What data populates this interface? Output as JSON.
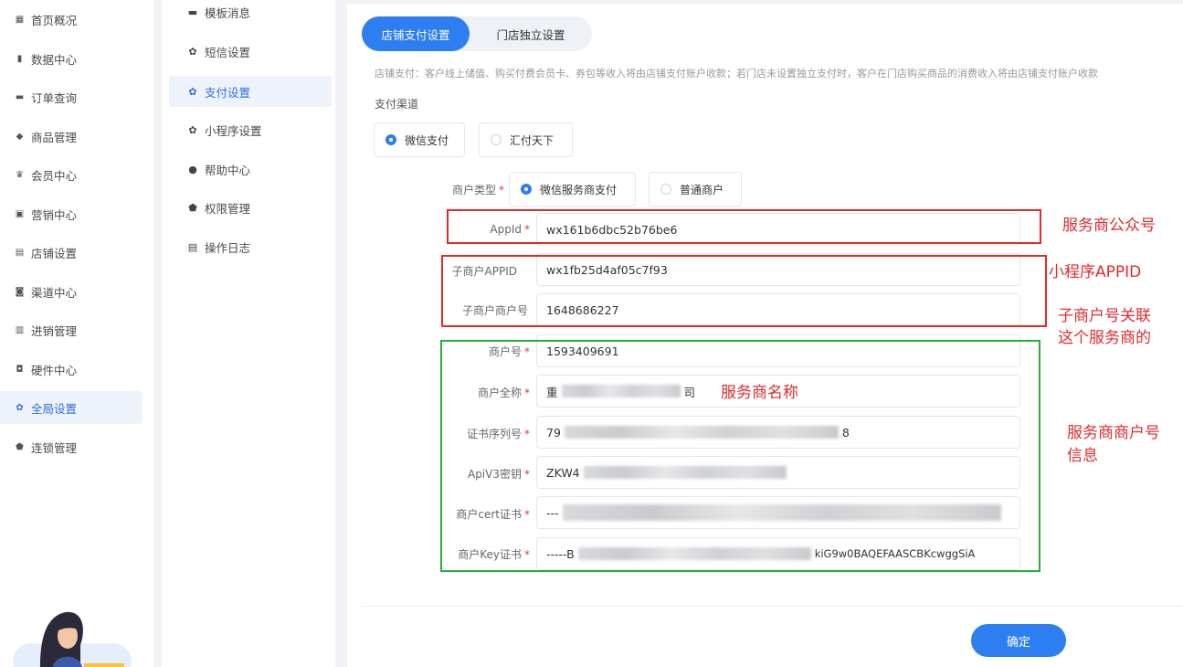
{
  "nav_primary": [
    {
      "label": "首页概况",
      "icon": "grid-icon"
    },
    {
      "label": "数据中心",
      "icon": "bar-chart-icon"
    },
    {
      "label": "订单查询",
      "icon": "order-icon"
    },
    {
      "label": "商品管理",
      "icon": "bag-icon"
    },
    {
      "label": "会员中心",
      "icon": "crown-icon"
    },
    {
      "label": "营销中心",
      "icon": "coupon-icon"
    },
    {
      "label": "店铺设置",
      "icon": "store-icon"
    },
    {
      "label": "渠道中心",
      "icon": "channel-icon"
    },
    {
      "label": "进销管理",
      "icon": "inventory-icon"
    },
    {
      "label": "硬件中心",
      "icon": "device-icon"
    },
    {
      "label": "全局设置",
      "icon": "gear-icon"
    },
    {
      "label": "连锁管理",
      "icon": "shield-icon"
    }
  ],
  "nav_secondary": [
    {
      "label": "模板消息",
      "icon": "message-icon"
    },
    {
      "label": "短信设置",
      "icon": "gear-icon"
    },
    {
      "label": "支付设置",
      "icon": "gear-icon"
    },
    {
      "label": "小程序设置",
      "icon": "gear-icon"
    },
    {
      "label": "帮助中心",
      "icon": "help-icon"
    },
    {
      "label": "权限管理",
      "icon": "shield-icon"
    },
    {
      "label": "操作日志",
      "icon": "log-icon"
    }
  ],
  "tabs": {
    "store": "店铺支付设置",
    "independent": "门店独立设置"
  },
  "description": "店铺支付：客户线上储值、购买付费会员卡、券包等收入将由店铺支付账户收款；若门店未设置独立支付时，客户在门店购买商品的消费收入将由店铺支付账户收款",
  "payment_channel": {
    "label": "支付渠道",
    "options": [
      "微信支付",
      "汇付天下"
    ],
    "selected": "微信支付"
  },
  "merchant_type": {
    "label": "商户类型",
    "options": [
      "微信服务商支付",
      "普通商户"
    ],
    "selected": "微信服务商支付"
  },
  "fields": {
    "appid": {
      "label": "AppId",
      "value": "wx161b6dbc52b76be6"
    },
    "sub_appid": {
      "label": "子商户APPID",
      "value": "wx1fb25d4af05c7f93"
    },
    "sub_mchid": {
      "label": "子商户商户号",
      "value": "1648686227"
    },
    "mchid": {
      "label": "商户号",
      "value": "1593409691"
    },
    "fullname": {
      "label": "商户全称",
      "prefix": "重",
      "suffix": "司"
    },
    "cert_serial": {
      "label": "证书序列号",
      "prefix": "79",
      "suffix": "8"
    },
    "apiv3": {
      "label": "ApiV3密钥",
      "prefix": "ZKW4"
    },
    "cert": {
      "label": "商户cert证书",
      "prefix": "---"
    },
    "key": {
      "label": "商户Key证书",
      "prefix": "-----B",
      "suffix": "kiG9w0BAQEFAASCBKcwggSiA"
    }
  },
  "annotations": {
    "service_account": "服务商公众号",
    "mini_app": "小程序APPID",
    "sub_link_1": "子商户号关联",
    "sub_link_2": "这个服务商的",
    "provider_name": "服务商名称",
    "provider_info_1": "服务商商户号",
    "provider_info_2": "信息"
  },
  "confirm_label": "确定",
  "colors": {
    "primary": "#2d7ef0",
    "annot_red": "#e02b2b",
    "annot_green": "#2eaa3a"
  }
}
